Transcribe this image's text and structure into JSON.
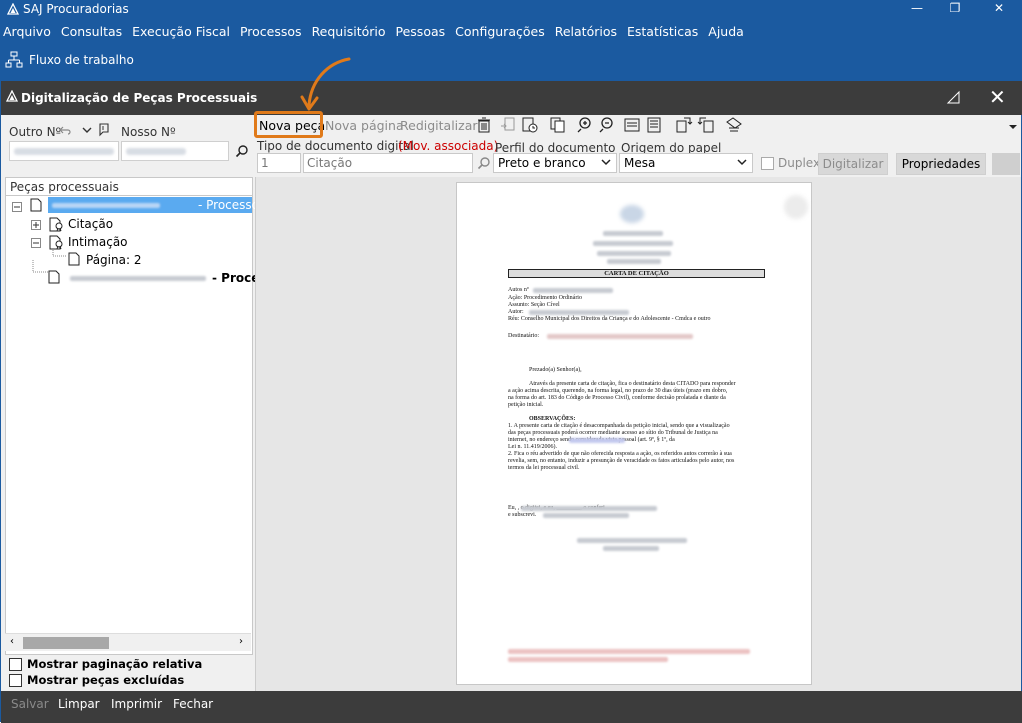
{
  "window": {
    "title": "SAJ Procuradorias",
    "minimize_glyph": "—",
    "restore_glyph": "❐",
    "close_glyph": "✕"
  },
  "menu": [
    "Arquivo",
    "Consultas",
    "Execução Fiscal",
    "Processos",
    "Requisitório",
    "Pessoas",
    "Configurações",
    "Relatórios",
    "Estatísticas",
    "Ajuda"
  ],
  "ribbon": {
    "flow_label": "Fluxo de trabalho"
  },
  "dialog": {
    "title": "Digitalização de Peças Processuais",
    "close_glyph": "✕"
  },
  "left": {
    "outro_label": "Outro Nº",
    "nosso_label": "Nosso Nº",
    "tree_header": "Peças processuais",
    "tree": [
      {
        "label": "- Processo C",
        "selected": true
      },
      {
        "label": "Citação"
      },
      {
        "label": "Intimação"
      },
      {
        "label": "Página: 2"
      },
      {
        "label": "- Process"
      }
    ],
    "options": [
      "Mostrar paginação relativa",
      "Mostrar peças excluídas"
    ]
  },
  "toolbar": {
    "nova_peca": "Nova peça",
    "nova_pagina": "Nova página",
    "redigitalizar": "Redigitalizar"
  },
  "form": {
    "tipo_label": "Tipo de documento digital",
    "mov_label": "(Mov. associada)",
    "tipo_code": "1",
    "tipo_text": "Citação",
    "perfil_label": "Perfil do documento",
    "perfil_value": "Preto e branco",
    "origem_label": "Origem do papel",
    "origem_value": "Mesa",
    "duplex_label": "Duplex",
    "digitalizar_label": "Digitalizar",
    "propriedades_label": "Propriedades"
  },
  "document": {
    "heading": "CARTA DE CITAÇÃO",
    "autos": "Autos nº",
    "acao": "Ação:  Procedimento Ordinário",
    "assunto": "Assunto: Seção Cível",
    "autor": "Autor:",
    "reu": "Réu:  Conselho Municipal dos Direitos da Criança e do Adolescente - Cmdca e outro",
    "destinatario": "Destinatário:",
    "saudacao": "Prezado(a) Senhor(a),",
    "corpo": [
      "Através da presente carta de citação, fica o destinatário desta CITADO para responder",
      "a ação acima descrita,  querendo, na forma legal, no prazo de 30 dias úteis (prazo em dobro,",
      "na forma do art. 183 do Código de Processo Civil), conforme decisão prolatada e diante da",
      "petição inicial."
    ],
    "obs_title": "OBSERVAÇÕES:",
    "obs": [
      "1. A presente carta de citação é desacompanhada da petição inicial, sendo que a visualização",
      "das peças processuais poderá ocorrer mediante acesso ao sítio do Tribunal de Justiça na",
      "internet, no endereço                         sendo considerada vista pessoal (art. 9º, § 1º, da",
      "Lei n. 11.419/2006).",
      "2. Fica o réu advertido de que não oferecida resposta a ação, os referidos autos correrão à sua",
      "revelia, sem, no entanto, induzir a presunção de veracidade os fatos articulados pelo autor, nos",
      "termos da lei processual civil."
    ],
    "fecho1": "Eu,                                                           , o digitei, e eu, ________, o conferi",
    "fecho2": "e subscrevi."
  },
  "bottom": {
    "salvar": "Salvar",
    "limpar": "Limpar",
    "imprimir": "Imprimir",
    "fechar": "Fechar"
  },
  "colors": {
    "brand": "#1b5aa0",
    "dark": "#3c3c3c",
    "highlight": "#e07a1a",
    "mov": "#cc0000",
    "selected": "#5aaaf0"
  }
}
